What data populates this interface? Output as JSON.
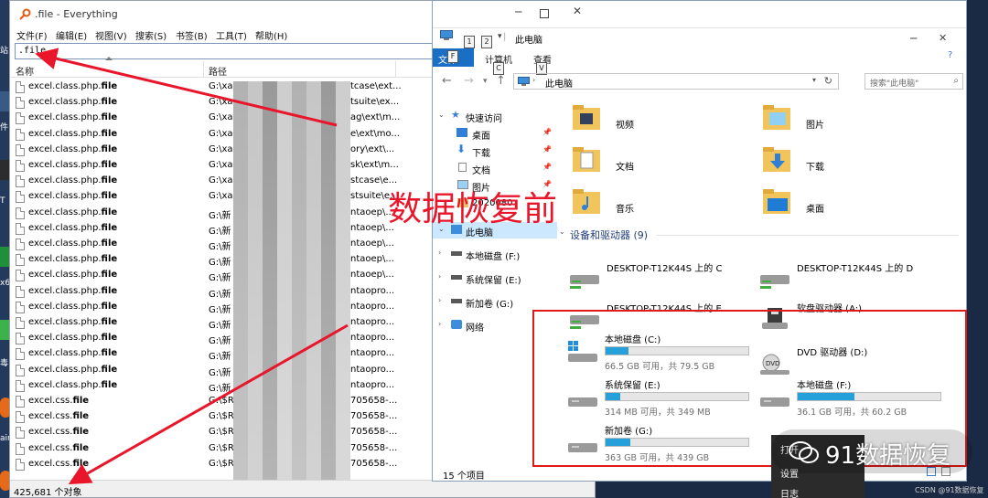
{
  "desktop": {
    "labels": [
      "站",
      "件",
      "T",
      "x6",
      "毒",
      "ain"
    ]
  },
  "everything": {
    "title": ".file - Everything",
    "menus": [
      "文件(F)",
      "编辑(E)",
      "视图(V)",
      "搜索(S)",
      "书签(B)",
      "工具(T)",
      "帮助(H)"
    ],
    "search_value": ".file",
    "columns": {
      "name": "名称",
      "path": "路径"
    },
    "rows": [
      {
        "name": "excel.class.php.",
        "ext": "file",
        "path_start": "G:\\xa",
        "path_end": "tcase\\ext..."
      },
      {
        "name": "excel.class.php.",
        "ext": "file",
        "path_start": "G:\\xa",
        "path_end": "tsuite\\ex..."
      },
      {
        "name": "excel.class.php.",
        "ext": "file",
        "path_start": "G:\\xa",
        "path_end": "ag\\ext\\m..."
      },
      {
        "name": "excel.class.php.",
        "ext": "file",
        "path_start": "G:\\xa",
        "path_end": "e\\ext\\mo..."
      },
      {
        "name": "excel.class.php.",
        "ext": "file",
        "path_start": "G:\\xa",
        "path_end": "ory\\ext\\..."
      },
      {
        "name": "excel.class.php.",
        "ext": "file",
        "path_start": "G:\\xa",
        "path_end": "sk\\ext\\m..."
      },
      {
        "name": "excel.class.php.",
        "ext": "file",
        "path_start": "G:\\xa",
        "path_end": "stcase\\e..."
      },
      {
        "name": "excel.class.php.",
        "ext": "file",
        "path_start": "G:\\xa",
        "path_end": "stsuite\\e..."
      },
      {
        "name": "excel.class.php.",
        "ext": "file",
        "path_start": "G:\\新",
        "path_end": "ntaoep\\..."
      },
      {
        "name": "excel.class.php.",
        "ext": "file",
        "path_start": "G:\\新",
        "path_end": "ntaoep\\..."
      },
      {
        "name": "excel.class.php.",
        "ext": "file",
        "path_start": "G:\\新",
        "path_end": "ntaoep\\..."
      },
      {
        "name": "excel.class.php.",
        "ext": "file",
        "path_start": "G:\\新",
        "path_end": "ntaoep\\..."
      },
      {
        "name": "excel.class.php.",
        "ext": "file",
        "path_start": "G:\\新",
        "path_end": "ntaoep\\..."
      },
      {
        "name": "excel.class.php.",
        "ext": "file",
        "path_start": "G:\\新",
        "path_end": "ntaopro..."
      },
      {
        "name": "excel.class.php.",
        "ext": "file",
        "path_start": "G:\\新",
        "path_end": "ntaopro..."
      },
      {
        "name": "excel.class.php.",
        "ext": "file",
        "path_start": "G:\\新",
        "path_end": "ntaopro..."
      },
      {
        "name": "excel.class.php.",
        "ext": "file",
        "path_start": "G:\\新",
        "path_end": "ntaopro..."
      },
      {
        "name": "excel.class.php.",
        "ext": "file",
        "path_start": "G:\\新",
        "path_end": "ntaopro..."
      },
      {
        "name": "excel.class.php.",
        "ext": "file",
        "path_start": "G:\\新",
        "path_end": "ntaopro..."
      },
      {
        "name": "excel.class.php.",
        "ext": "file",
        "path_start": "G:\\新",
        "path_end": "ntaopro..."
      },
      {
        "name": "excel.css.",
        "ext": "file",
        "path_start": "G:\\$R",
        "path_end": "705658-..."
      },
      {
        "name": "excel.css.",
        "ext": "file",
        "path_start": "G:\\$R",
        "path_end": "705658-..."
      },
      {
        "name": "excel.css.",
        "ext": "file",
        "path_start": "G:\\$R",
        "path_end": "705658-..."
      },
      {
        "name": "excel.css.",
        "ext": "file",
        "path_start": "G:\\$R",
        "path_end": "705658-..."
      },
      {
        "name": "excel.css.",
        "ext": "file",
        "path_start": "G:\\$R",
        "path_end": "705658-..."
      }
    ],
    "status": "425,681 个对象"
  },
  "explorer": {
    "title": "此电脑",
    "tabs": {
      "file": "文件",
      "computer": "计算机",
      "view": "查看"
    },
    "keytips": {
      "qat1": "1",
      "qat2": "2",
      "file": "F",
      "computer": "C",
      "view": "V"
    },
    "address": "此电脑",
    "search_placeholder": "搜索\"此电脑\"",
    "nav": {
      "quick_access": "快速访问",
      "desktop": "桌面",
      "downloads": "下载",
      "documents": "文档",
      "pictures": "图片",
      "partial_item": "2020080",
      "this_pc": "此电脑",
      "local_f": "本地磁盘 (F:)",
      "reserved_e": "系统保留 (E:)",
      "new_vol_g": "新加卷 (G:)",
      "network": "网络"
    },
    "folders": [
      "视频",
      "图片",
      "文档",
      "下载",
      "音乐",
      "桌面"
    ],
    "section_title": "设备和驱动器 (9)",
    "network_drives": [
      "DESKTOP-T12K44S 上的 C",
      "DESKTOP-T12K44S 上的 D",
      "DESKTOP-T12K44S 上的 E",
      "软盘驱动器 (A:)"
    ],
    "drives": [
      {
        "name": "本地磁盘 (C:)",
        "info": "66.5 GB 可用，共 79.5 GB",
        "used_fraction": 0.16
      },
      {
        "name": "DVD 驱动器 (D:)",
        "info": "",
        "used_fraction": null
      },
      {
        "name": "系统保留 (E:)",
        "info": "314 MB 可用，共 349 MB",
        "used_fraction": 0.1
      },
      {
        "name": "本地磁盘 (F:)",
        "info": "36.1 GB 可用，共 60.2 GB",
        "used_fraction": 0.4
      },
      {
        "name": "新加卷 (G:)",
        "info": "363 GB 可用，共 439 GB",
        "used_fraction": 0.17
      }
    ],
    "status": "15 个项目"
  },
  "overlay": {
    "annotation": "数据恢复前",
    "watermark": "91数据恢复",
    "credit": "CSDN @91数据恢复",
    "context_menu": [
      "打开",
      "设置",
      "日志"
    ]
  },
  "colors": {
    "annotation_red": "#e8152b",
    "drive_bar": "#26a0da",
    "ribbon_file": "#1a6fc4",
    "nav_selected": "#cce8ff"
  }
}
